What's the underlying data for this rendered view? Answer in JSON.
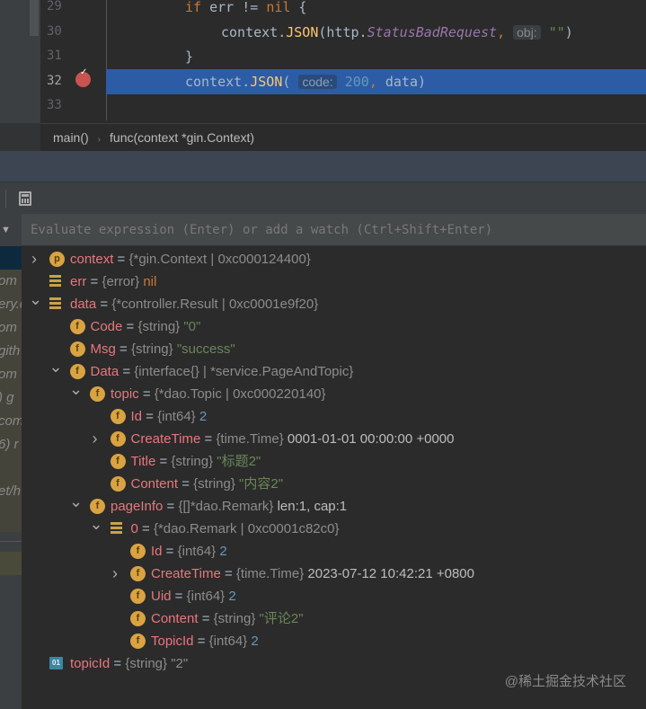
{
  "editor": {
    "lines": [
      {
        "num": "29",
        "html_parts": [
          [
            "kw",
            "if "
          ],
          [
            "",
            "err != "
          ],
          [
            "kw",
            "nil"
          ],
          [
            "",
            " {"
          ]
        ],
        "indent": 0
      },
      {
        "num": "30",
        "html_parts": [
          [
            "",
            "context."
          ],
          [
            "fn",
            "JSON"
          ],
          [
            "",
            "(http."
          ],
          [
            "it",
            "StatusBadRequest"
          ],
          [
            "kw",
            ", "
          ],
          [
            "hint",
            "obj:"
          ],
          [
            "str",
            " \"\""
          ],
          [
            "",
            ")"
          ]
        ],
        "indent": 1
      },
      {
        "num": "31",
        "html_parts": [
          [
            "",
            "}"
          ]
        ],
        "indent": 0
      },
      {
        "num": "32",
        "html_parts": [
          [
            "",
            "context."
          ],
          [
            "fn",
            "JSON"
          ],
          [
            "",
            "( "
          ],
          [
            "hint",
            "code:"
          ],
          [
            "num",
            " 200"
          ],
          [
            "kw",
            ", "
          ],
          [
            "",
            "data)"
          ]
        ],
        "indent": 0,
        "current": true
      },
      {
        "num": "33",
        "html_parts": [],
        "indent": 0
      }
    ],
    "highlight_color": "#2c5ca6",
    "breakpoint_color": "#c75450"
  },
  "breadcrumb": [
    "main()",
    "func(context *gin.Context)"
  ],
  "evaluate": {
    "placeholder": "Evaluate expression (Enter) or add a watch (Ctrl+Shift+Enter)"
  },
  "frames": [
    "om",
    "ery.c",
    "om",
    "gith",
    "om",
    ") g",
    "com",
    "6) r",
    "",
    "et/h"
  ],
  "variables": [
    {
      "level": 0,
      "arrow": "right",
      "icon": "p",
      "name": "context",
      "type": "{*gin.Context | 0xc000124400}",
      "value": "",
      "vclass": "grey"
    },
    {
      "level": 0,
      "arrow": "",
      "icon": "list",
      "name": "err",
      "type": "{error}",
      "value": "nil",
      "vclass": "kw"
    },
    {
      "level": 0,
      "arrow": "down",
      "icon": "list",
      "name": "data",
      "type": "{*controller.Result | 0xc0001e9f20}",
      "value": "",
      "vclass": "grey"
    },
    {
      "level": 1,
      "arrow": "",
      "icon": "f",
      "name": "Code",
      "type": "{string}",
      "value": "\"0\"",
      "vclass": "str"
    },
    {
      "level": 1,
      "arrow": "",
      "icon": "f",
      "name": "Msg",
      "type": "{string}",
      "value": "\"success\"",
      "vclass": "str"
    },
    {
      "level": 1,
      "arrow": "down",
      "icon": "f",
      "name": "Data",
      "type": "{interface{} | *service.PageAndTopic}",
      "value": "",
      "vclass": "grey"
    },
    {
      "level": 2,
      "arrow": "down",
      "icon": "f",
      "name": "topic",
      "type": "{*dao.Topic | 0xc000220140}",
      "value": "",
      "vclass": "grey"
    },
    {
      "level": 3,
      "arrow": "",
      "icon": "f",
      "name": "Id",
      "type": "{int64}",
      "value": "2",
      "vclass": "num"
    },
    {
      "level": 3,
      "arrow": "right",
      "icon": "f",
      "name": "CreateTime",
      "type": "{time.Time}",
      "value": "0001-01-01 00:00:00 +0000",
      "vclass": "plain"
    },
    {
      "level": 3,
      "arrow": "",
      "icon": "f",
      "name": "Title",
      "type": "{string}",
      "value": "\"标题2\"",
      "vclass": "str"
    },
    {
      "level": 3,
      "arrow": "",
      "icon": "f",
      "name": "Content",
      "type": "{string}",
      "value": "\"内容2\"",
      "vclass": "str"
    },
    {
      "level": 2,
      "arrow": "down",
      "icon": "f",
      "name": "pageInfo",
      "type": "{[]*dao.Remark}",
      "value": "len:1, cap:1",
      "vclass": "plain"
    },
    {
      "level": 3,
      "arrow": "down",
      "icon": "list",
      "name": "0",
      "type": "{*dao.Remark | 0xc0001c82c0}",
      "value": "",
      "vclass": "grey"
    },
    {
      "level": 4,
      "arrow": "",
      "icon": "f",
      "name": "Id",
      "type": "{int64}",
      "value": "2",
      "vclass": "num"
    },
    {
      "level": 4,
      "arrow": "right",
      "icon": "f",
      "name": "CreateTime",
      "type": "{time.Time}",
      "value": "2023-07-12 10:42:21 +0800",
      "vclass": "plain"
    },
    {
      "level": 4,
      "arrow": "",
      "icon": "f",
      "name": "Uid",
      "type": "{int64}",
      "value": "2",
      "vclass": "num"
    },
    {
      "level": 4,
      "arrow": "",
      "icon": "f",
      "name": "Content",
      "type": "{string}",
      "value": "\"评论2\"",
      "vclass": "str"
    },
    {
      "level": 4,
      "arrow": "",
      "icon": "f",
      "name": "TopicId",
      "type": "{int64}",
      "value": "2",
      "vclass": "num"
    },
    {
      "level": 0,
      "arrow": "",
      "icon": "prim",
      "name": "topicId",
      "type": "{string}",
      "value": "\"2\"",
      "vclass": "grey"
    }
  ],
  "watermark": "@稀土掘金技术社区"
}
